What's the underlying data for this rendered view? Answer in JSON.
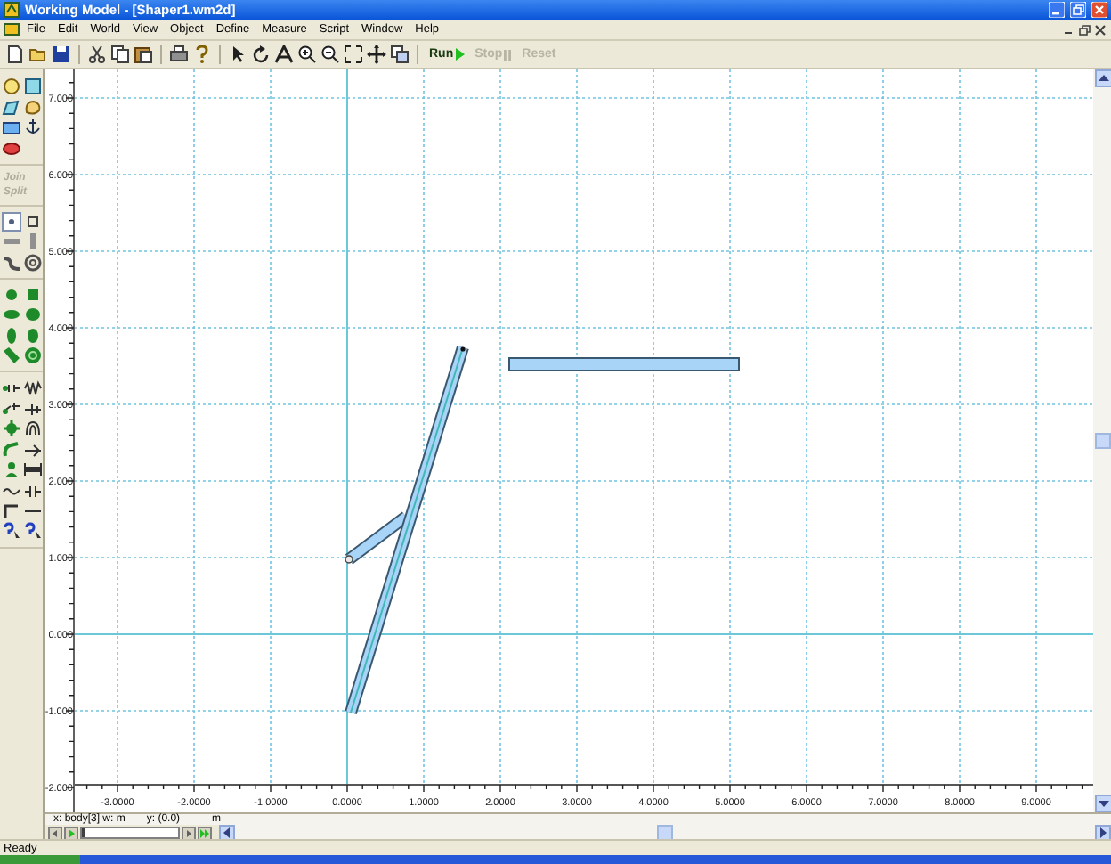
{
  "window": {
    "title": "Working Model - [Shaper1.wm2d]"
  },
  "menu": [
    "File",
    "Edit",
    "World",
    "View",
    "Object",
    "Define",
    "Measure",
    "Script",
    "Window",
    "Help"
  ],
  "run_controls": [
    {
      "label": "Run",
      "disabled": false
    },
    {
      "label": "Stop",
      "disabled": true
    },
    {
      "label": "Reset",
      "disabled": true
    }
  ],
  "palette_buttons": [
    {
      "label": "Join",
      "disabled": true
    },
    {
      "label": "Split",
      "disabled": true
    }
  ],
  "rulers": {
    "x_labels": [
      "-3.0000",
      "-2.0000",
      "-1.0000",
      "0.0000",
      "1.0000",
      "2.0000",
      "3.0000",
      "4.0000",
      "5.0000",
      "6.0000",
      "7.0000",
      "8.0000",
      "9.0000"
    ],
    "y_labels": [
      "7.000",
      "6.000",
      "5.000",
      "4.000",
      "3.000",
      "2.000",
      "1.000",
      "0.000",
      "-1.000",
      "-2.000"
    ]
  },
  "playback": {
    "level": 0
  },
  "coordinates": [
    "x: body[3] w: m",
    "y: (0.0)",
    "m"
  ],
  "status_bar": "Ready"
}
